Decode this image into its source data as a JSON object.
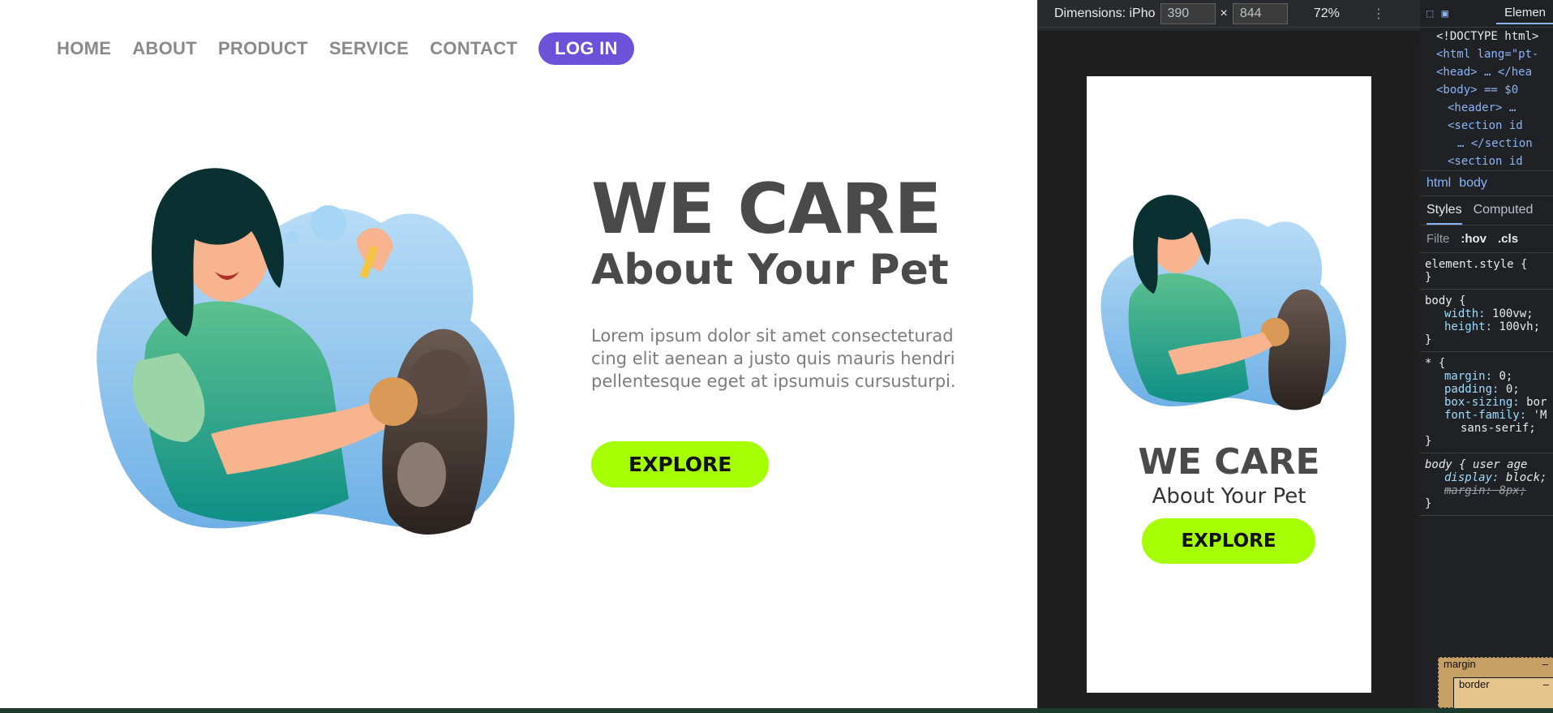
{
  "nav": {
    "items": [
      "HOME",
      "ABOUT",
      "PRODUCT",
      "SERVICE",
      "CONTACT"
    ],
    "login_label": "LOG IN"
  },
  "hero": {
    "title": "WE CARE",
    "subtitle": "About Your Pet",
    "body_lines": [
      "Lorem ipsum dolor sit amet consecteturad",
      "cing elit aenean a justo quis mauris hendri",
      "pellentesque eget at ipsumuis cursusturpi."
    ],
    "cta_label": "EXPLORE"
  },
  "devtools": {
    "dimensions_label": "Dimensions: iPho",
    "width": "390",
    "height": "844",
    "zoom": "72%",
    "elements_tab": "Elemen",
    "dom_lines": [
      "<!DOCTYPE html>",
      "<html lang=\"pt-",
      "<head> … </hea",
      "<body> == $0",
      "<header> …",
      "<section id",
      "… </section",
      "<section id"
    ],
    "breadcrumbs": [
      "html",
      "body"
    ],
    "panel_tabs": [
      "Styles",
      "Computed"
    ],
    "filter_placeholder": "Filte",
    "filter_hov": ":hov",
    "filter_cls": ".cls",
    "rules": [
      {
        "selector": "element.style {",
        "props": [],
        "close": "}"
      },
      {
        "selector": "body {",
        "props": [
          [
            "width",
            "100vw;"
          ],
          [
            "height",
            "100vh;"
          ]
        ],
        "close": "}"
      },
      {
        "selector": "* {",
        "props": [
          [
            "margin",
            "0;"
          ],
          [
            "padding",
            "0;"
          ],
          [
            "box-sizing",
            "bor"
          ],
          [
            "font-family",
            "'M"
          ],
          [
            "",
            "sans-serif;"
          ]
        ],
        "close": "}"
      },
      {
        "selector": "body {    user age",
        "props": [
          [
            "display",
            "block;"
          ],
          [
            "margin",
            "8px;"
          ]
        ],
        "close": "}"
      }
    ],
    "box_margin": "margin",
    "box_border": "border",
    "box_dash": "–"
  },
  "phone_preview": {
    "title": "WE CARE",
    "subtitle": "About Your Pet",
    "cta_label": "EXPLORE"
  }
}
